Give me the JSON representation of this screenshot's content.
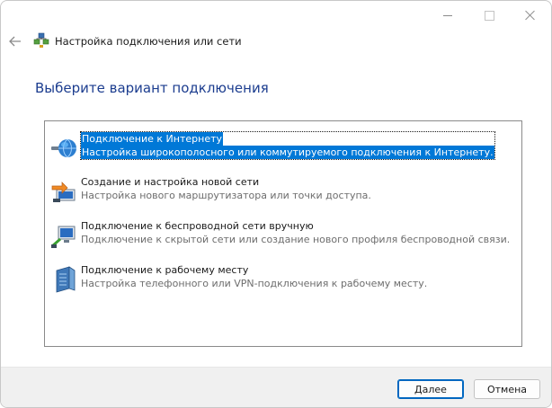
{
  "window": {
    "title": "Настройка подключения или сети"
  },
  "page": {
    "heading": "Выберите вариант подключения"
  },
  "options": [
    {
      "title": "Подключение к Интернету",
      "description": "Настройка широкополосного или коммутируемого подключения к Интернету.",
      "icon": "globe-network-icon",
      "selected": true
    },
    {
      "title": "Создание и настройка новой сети",
      "description": "Настройка нового маршрутизатора или точки доступа.",
      "icon": "new-network-icon",
      "selected": false
    },
    {
      "title": "Подключение к беспроводной сети вручную",
      "description": "Подключение к скрытой сети или создание нового профиля беспроводной связи.",
      "icon": "wireless-network-icon",
      "selected": false
    },
    {
      "title": "Подключение к рабочему месту",
      "description": "Настройка телефонного или VPN-подключения к рабочему месту.",
      "icon": "workplace-vpn-icon",
      "selected": false
    }
  ],
  "footer": {
    "next_label": "Далее",
    "cancel_label": "Отмена"
  },
  "colors": {
    "accent": "#0078d7",
    "heading": "#1c3d8f"
  }
}
